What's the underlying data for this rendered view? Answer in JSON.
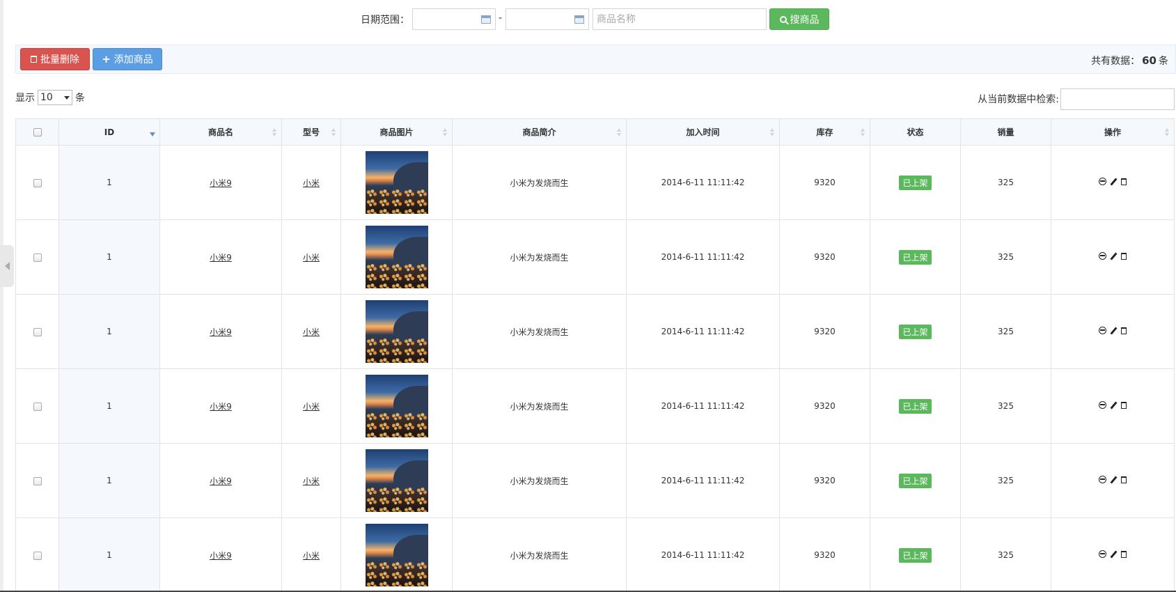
{
  "search": {
    "date_label": "日期范围：",
    "date_separator": "-",
    "name_placeholder": "商品名称",
    "button_label": "搜商品"
  },
  "toolbar": {
    "batch_delete_label": "批量删除",
    "add_label": "添加商品",
    "total_prefix": "共有数据：",
    "total_count": "60",
    "total_suffix": "条"
  },
  "length": {
    "prefix": "显示",
    "value": "10",
    "suffix": "条"
  },
  "filter": {
    "label": "从当前数据中检索:"
  },
  "table": {
    "headers": [
      "",
      "ID",
      "商品名",
      "型号",
      "商品图片",
      "商品简介",
      "加入时间",
      "库存",
      "状态",
      "销量",
      "操作"
    ],
    "rows": [
      {
        "id": "1",
        "name": "小米9",
        "model": "小米",
        "desc": "小米为发烧而生",
        "time": "2014-6-11 11:11:42",
        "stock": "9320",
        "status": "已上架",
        "sales": "325"
      },
      {
        "id": "1",
        "name": "小米9",
        "model": "小米",
        "desc": "小米为发烧而生",
        "time": "2014-6-11 11:11:42",
        "stock": "9320",
        "status": "已上架",
        "sales": "325"
      },
      {
        "id": "1",
        "name": "小米9",
        "model": "小米",
        "desc": "小米为发烧而生",
        "time": "2014-6-11 11:11:42",
        "stock": "9320",
        "status": "已上架",
        "sales": "325"
      },
      {
        "id": "1",
        "name": "小米9",
        "model": "小米",
        "desc": "小米为发烧而生",
        "time": "2014-6-11 11:11:42",
        "stock": "9320",
        "status": "已上架",
        "sales": "325"
      },
      {
        "id": "1",
        "name": "小米9",
        "model": "小米",
        "desc": "小米为发烧而生",
        "time": "2014-6-11 11:11:42",
        "stock": "9320",
        "status": "已上架",
        "sales": "325"
      },
      {
        "id": "1",
        "name": "小米9",
        "model": "小米",
        "desc": "小米为发烧而生",
        "time": "2014-6-11 11:11:42",
        "stock": "9320",
        "status": "已上架",
        "sales": "325"
      }
    ]
  },
  "icons": {
    "search": "magnifier-icon",
    "batch_delete": "trash-icon",
    "add": "plus-icon",
    "date": "calendar-icon",
    "sidebar": "collapse-arrow-icon",
    "ops": [
      "disable-icon",
      "edit-icon",
      "delete-icon"
    ]
  },
  "colors": {
    "success": "#5cb85c",
    "danger": "#d9534f",
    "primary": "#5b9ee3",
    "header_bg": "#f5f9fd"
  }
}
